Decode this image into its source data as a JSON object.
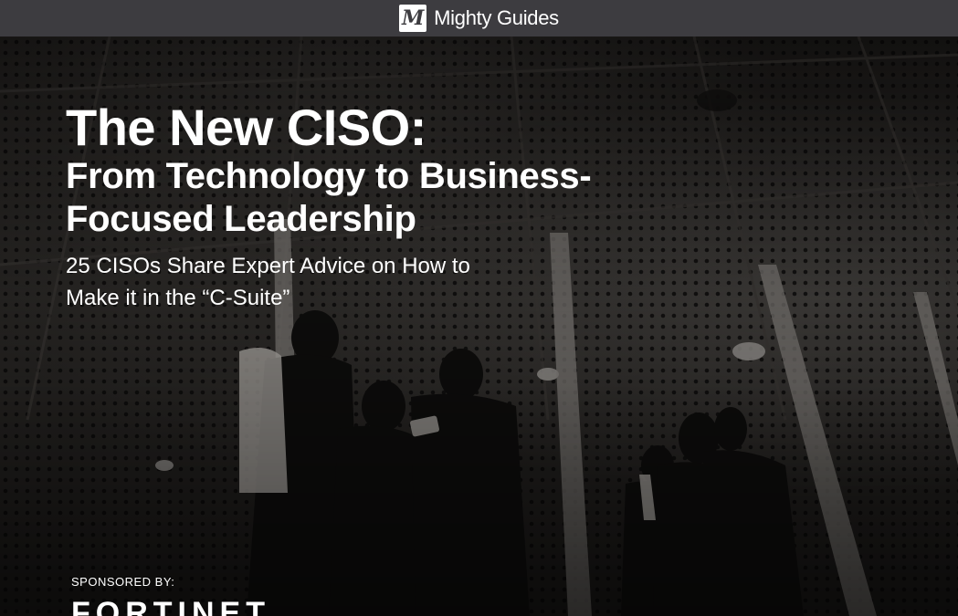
{
  "header": {
    "brand_mark": "M",
    "brand_name": "Mighty Guides"
  },
  "cover": {
    "title": "The New CISO:",
    "subtitle": "From Technology to Business-Focused Leadership",
    "tagline": "25 CISOs Share Expert Advice on How to Make it in the “C-Suite”",
    "sponsor_label": "SPONSORED BY:",
    "sponsor_logo": "FORTINET"
  },
  "colors": {
    "topbar": "#3d3c40",
    "text": "#ffffff"
  }
}
